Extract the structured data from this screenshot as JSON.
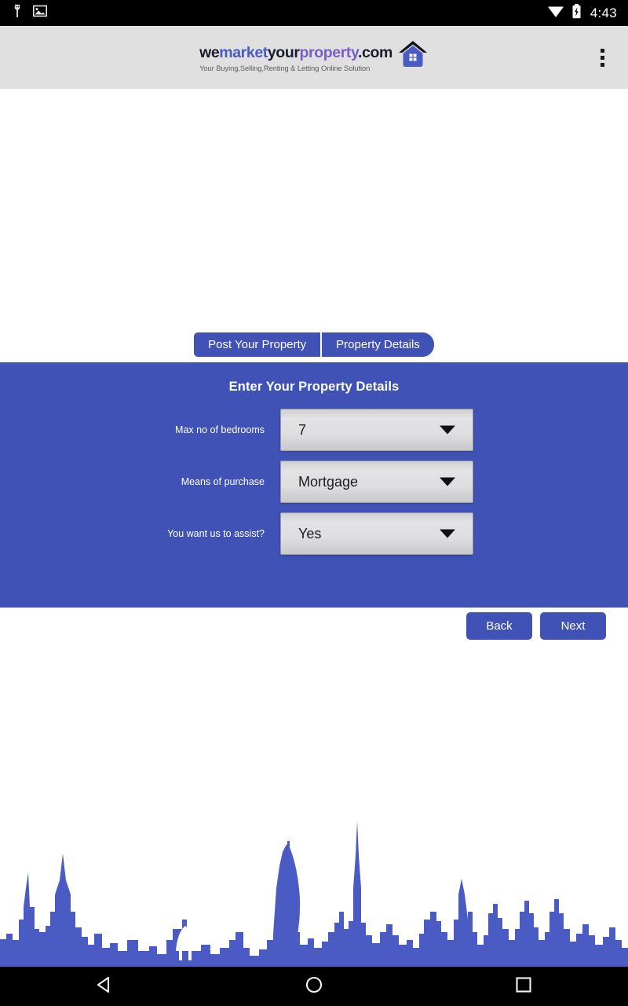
{
  "status_bar": {
    "time": "4:43",
    "icons_left": [
      "android-robot-icon",
      "image-icon"
    ],
    "icons_right": [
      "wifi-icon",
      "battery-charging-icon"
    ],
    "background": "#000000"
  },
  "app_header": {
    "background": "#e0e0e0",
    "logo": {
      "part1": "we",
      "part2": "market",
      "part3": "your",
      "part4": "property",
      "part5": ".com",
      "tagline": "Your Buying,Selling,Renting & Letting Online Solution",
      "house_icon": "house-icon",
      "brand_blue": "#4a5bc4",
      "brand_purple": "#7b5ec7",
      "brand_dark": "#1b1b2f"
    },
    "overflow_menu": "more-vert-icon"
  },
  "tabs": [
    {
      "label": "Post Your Property",
      "selected": false
    },
    {
      "label": "Property Details",
      "selected": true
    }
  ],
  "form": {
    "title": "Enter Your Property Details",
    "panel_color": "#4052b5",
    "fields": [
      {
        "label": "Max no of bedrooms",
        "value": "7",
        "control": "dropdown"
      },
      {
        "label": "Means of purchase",
        "value": "Mortgage",
        "control": "dropdown"
      },
      {
        "label": "You want us to assist?",
        "value": "Yes",
        "control": "dropdown"
      }
    ]
  },
  "actions": {
    "back_label": "Back",
    "next_label": "Next",
    "button_color": "#4052b5"
  },
  "skyline": {
    "description": "Dubai skyline silhouette",
    "color": "#4a5bc4"
  },
  "nav_bar": {
    "items": [
      {
        "name": "back-triangle-icon"
      },
      {
        "name": "home-circle-icon"
      },
      {
        "name": "recents-square-icon"
      }
    ],
    "background": "#000000"
  }
}
